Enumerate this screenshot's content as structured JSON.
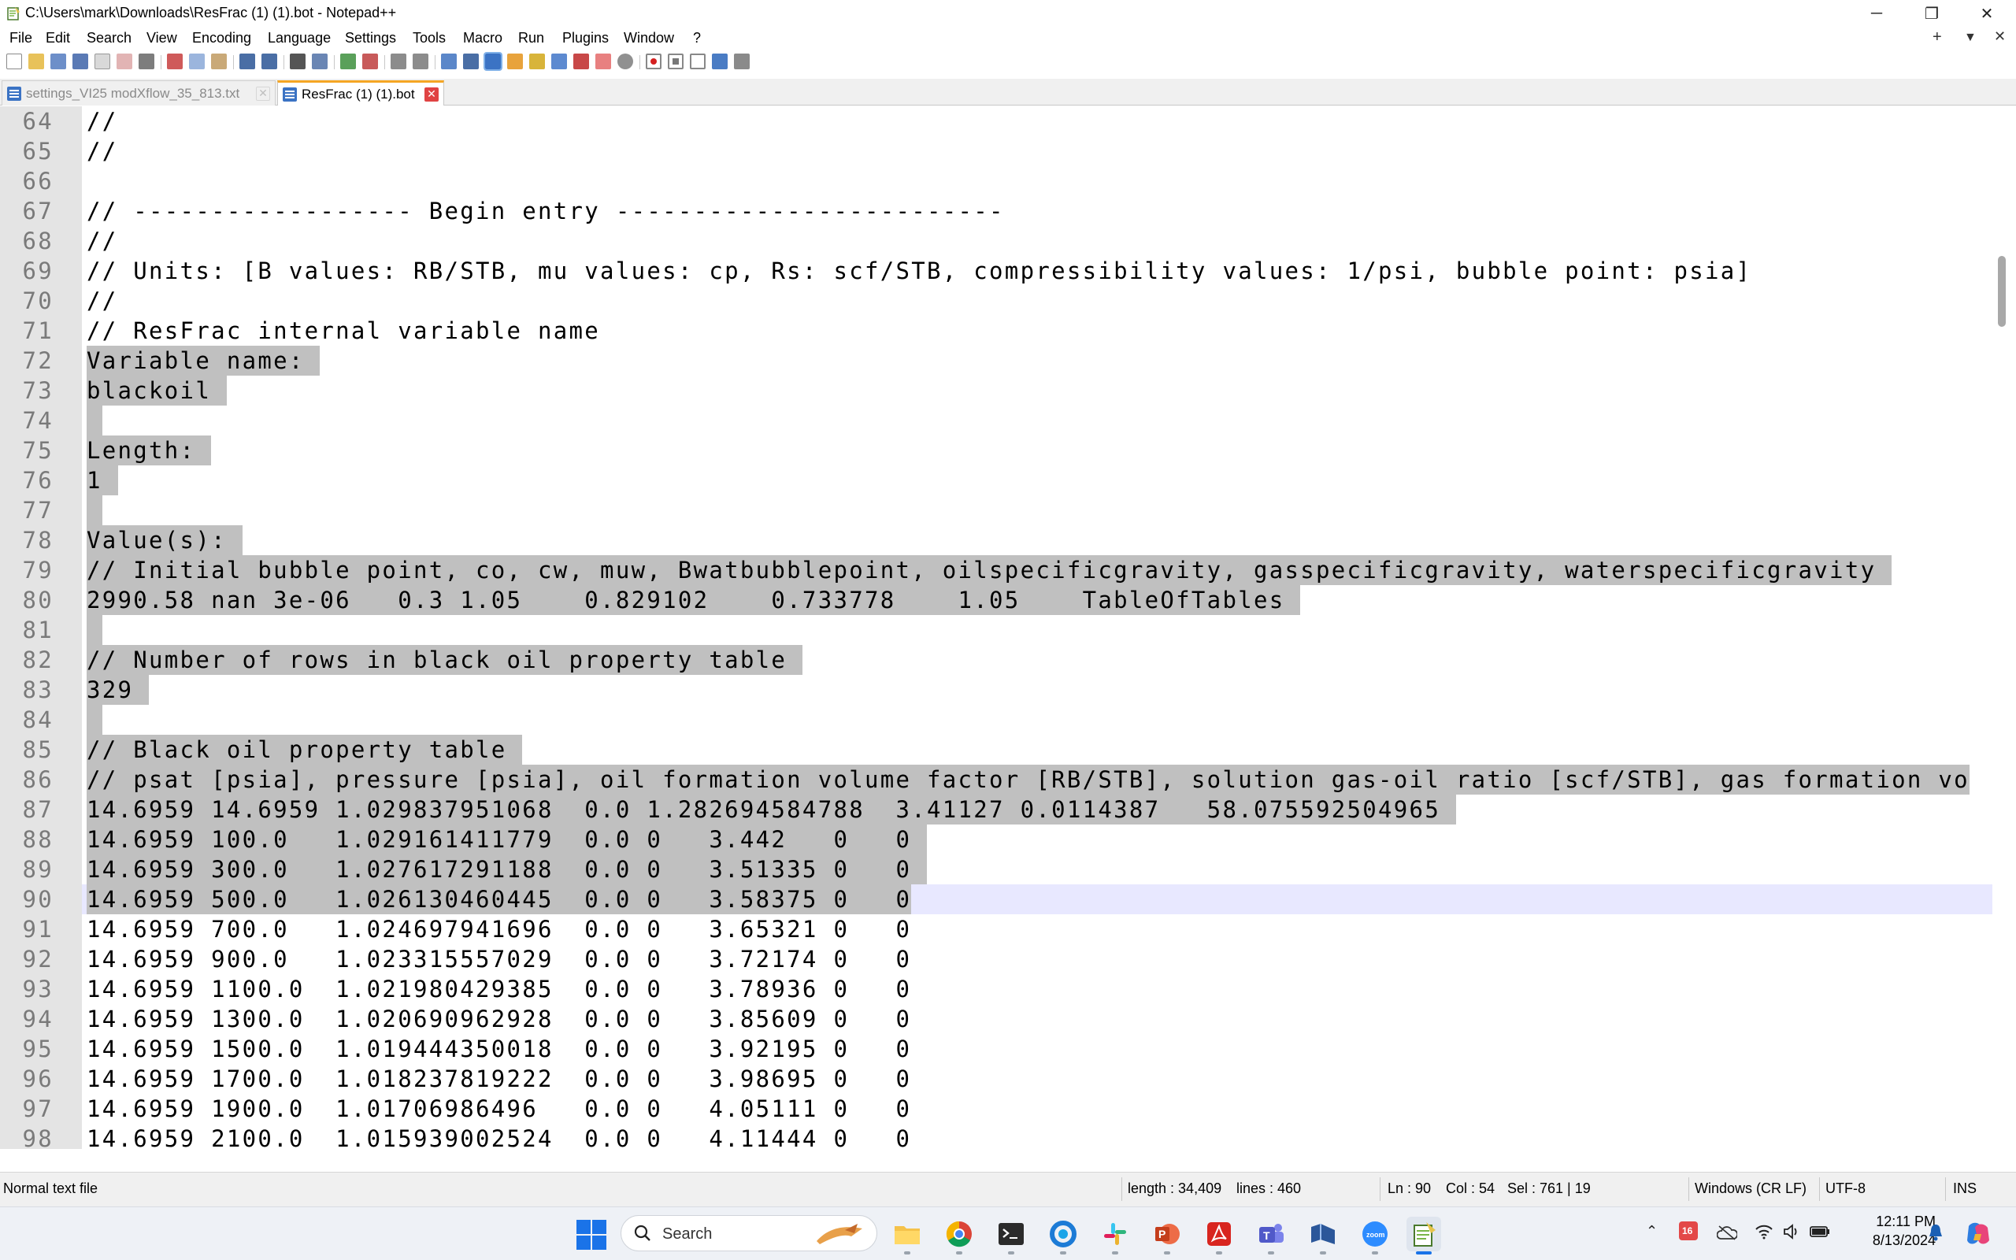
{
  "window": {
    "title": "C:\\Users\\mark\\Downloads\\ResFrac (1) (1).bot - Notepad++",
    "minimize_glyph": "─",
    "maximize_glyph": "❐",
    "close_glyph": "✕"
  },
  "menu": {
    "items": [
      "File",
      "Edit",
      "Search",
      "View",
      "Encoding",
      "Language",
      "Settings",
      "Tools",
      "Macro",
      "Run",
      "Plugins",
      "Window",
      "?"
    ],
    "right_plus": "+",
    "right_down": "▼",
    "right_close": "✕"
  },
  "tabs": [
    {
      "label": "settings_VI25 modXflow_35_813.txt",
      "close": "✕",
      "active": false
    },
    {
      "label": "ResFrac (1) (1).bot",
      "close": "✕",
      "active": true
    }
  ],
  "editor": {
    "current_line": 90,
    "lines": [
      {
        "n": "64",
        "text": "//",
        "selected": false
      },
      {
        "n": "65",
        "text": "//",
        "selected": false
      },
      {
        "n": "66",
        "text": "",
        "selected": false
      },
      {
        "n": "67",
        "text": "// ------------------ Begin entry -------------------------",
        "selected": false
      },
      {
        "n": "68",
        "text": "//",
        "selected": false
      },
      {
        "n": "69",
        "text": "// Units: [B values: RB/STB, mu values: cp, Rs: scf/STB, compressibility values: 1/psi, bubble point: psia]",
        "selected": false
      },
      {
        "n": "70",
        "text": "//",
        "selected": false
      },
      {
        "n": "71",
        "text": "// ResFrac internal variable name",
        "selected": false
      },
      {
        "n": "72",
        "text": "Variable name: ",
        "selected": true
      },
      {
        "n": "73",
        "text": "blackoil ",
        "selected": true
      },
      {
        "n": "74",
        "text": " ",
        "selected": true
      },
      {
        "n": "75",
        "text": "Length: ",
        "selected": true
      },
      {
        "n": "76",
        "text": "1 ",
        "selected": true
      },
      {
        "n": "77",
        "text": " ",
        "selected": true
      },
      {
        "n": "78",
        "text": "Value(s): ",
        "selected": true
      },
      {
        "n": "79",
        "text": "// Initial bubble point, co, cw, muw, Bwatbubblepoint, oilspecificgravity, gasspecificgravity, waterspecificgravity ",
        "selected": true
      },
      {
        "n": "80",
        "text": "2990.58 nan 3e-06   0.3 1.05    0.829102    0.733778    1.05    TableOfTables ",
        "selected": true
      },
      {
        "n": "81",
        "text": " ",
        "selected": true
      },
      {
        "n": "82",
        "text": "// Number of rows in black oil property table ",
        "selected": true
      },
      {
        "n": "83",
        "text": "329 ",
        "selected": true
      },
      {
        "n": "84",
        "text": " ",
        "selected": true
      },
      {
        "n": "85",
        "text": "// Black oil property table ",
        "selected": true
      },
      {
        "n": "86",
        "text": "// psat [psia], pressure [psia], oil formation volume factor [RB/STB], solution gas-oil ratio [scf/STB], gas formation vo",
        "selected": true
      },
      {
        "n": "87",
        "text": "14.6959 14.6959 1.029837951068  0.0 1.282694584788  3.41127 0.0114387   58.075592504965 ",
        "selected": true
      },
      {
        "n": "88",
        "text": "14.6959 100.0   1.029161411779  0.0 0   3.442   0   0 ",
        "selected": true
      },
      {
        "n": "89",
        "text": "14.6959 300.0   1.027617291188  0.0 0   3.51335 0   0 ",
        "selected": true
      },
      {
        "n": "90",
        "text": "14.6959 500.0   1.026130460445  0.0 0   3.58375 0   0",
        "selected": true
      },
      {
        "n": "91",
        "text": "14.6959 700.0   1.024697941696  0.0 0   3.65321 0   0",
        "selected": false
      },
      {
        "n": "92",
        "text": "14.6959 900.0   1.023315557029  0.0 0   3.72174 0   0",
        "selected": false
      },
      {
        "n": "93",
        "text": "14.6959 1100.0  1.021980429385  0.0 0   3.78936 0   0",
        "selected": false
      },
      {
        "n": "94",
        "text": "14.6959 1300.0  1.020690962928  0.0 0   3.85609 0   0",
        "selected": false
      },
      {
        "n": "95",
        "text": "14.6959 1500.0  1.019444350018  0.0 0   3.92195 0   0",
        "selected": false
      },
      {
        "n": "96",
        "text": "14.6959 1700.0  1.018237819222  0.0 0   3.98695 0   0",
        "selected": false
      },
      {
        "n": "97",
        "text": "14.6959 1900.0  1.01706986496   0.0 0   4.05111 0   0",
        "selected": false
      },
      {
        "n": "98",
        "text": "14.6959 2100.0  1.015939002524  0.0 0   4.11444 0   0",
        "selected": false
      }
    ]
  },
  "status": {
    "file_type": "Normal text file",
    "length": "length : 34,409",
    "lines": "lines : 460",
    "ln": "Ln : 90",
    "col": "Col : 54",
    "sel": "Sel : 761 | 19",
    "eol": "Windows (CR LF)",
    "encoding": "UTF-8",
    "mode": "INS"
  },
  "taskbar": {
    "search_label": "Search",
    "clock_time": "12:11 PM",
    "clock_date": "8/13/2024",
    "calendar_badge": "16",
    "apps": [
      "file-explorer",
      "chrome",
      "terminal",
      "outlook",
      "slack",
      "powerpoint",
      "acrobat",
      "teams",
      "app-blue",
      "zoom",
      "notepad-plus-plus"
    ],
    "accent_color": "#1a73e8"
  }
}
